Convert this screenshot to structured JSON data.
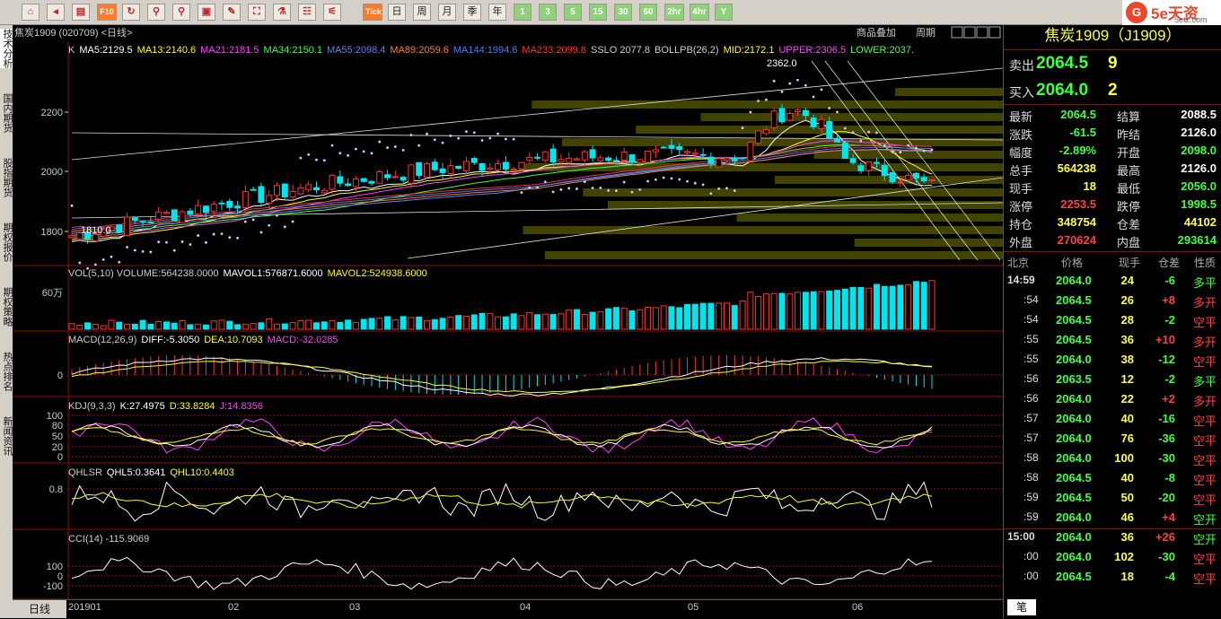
{
  "toolbar": {
    "buttons": [
      "⌂",
      "◂",
      "▤",
      "F10",
      "↻",
      "⚲",
      "⚲",
      "▣",
      "✎",
      "⛶",
      "⚗",
      "☷",
      "⚟",
      "Tick",
      "日",
      "周",
      "月",
      "季",
      "年",
      "1",
      "3",
      "5",
      "15",
      "30",
      "60",
      "2hr",
      "4hr",
      "Y"
    ],
    "logo": {
      "mark": "G",
      "brand": "5e天资",
      "domain": "5etz.com"
    }
  },
  "sidebar": [
    "技术分析",
    "国内期货",
    "股指期货",
    "期权报价",
    "期权策略",
    "热点排名",
    "新闻资讯"
  ],
  "chart": {
    "header": "焦炭1909 (020709) <日线>",
    "ma_legend": [
      {
        "text": "K",
        "color": "#cccccc"
      },
      {
        "text": "MA5:2129.5",
        "color": "#ffffff"
      },
      {
        "text": "MA13:2140.6",
        "color": "#ffff00"
      },
      {
        "text": "MA21:2181.5",
        "color": "#ff40ff"
      },
      {
        "text": "MA34:2150.1",
        "color": "#40ff40"
      },
      {
        "text": "MA55:2098.4",
        "color": "#6080ff"
      },
      {
        "text": "MA89:2059.6",
        "color": "#ff8020"
      },
      {
        "text": "MA144:1994.6",
        "color": "#4080ff"
      },
      {
        "text": "MA233:2099.8",
        "color": "#ff3030"
      },
      {
        "text": "SSLO 2077.8",
        "color": "#cccccc"
      },
      {
        "text": "BOLLPB(26,2)",
        "color": "#cccccc"
      },
      {
        "text": "MID:2172.1",
        "color": "#ffff00"
      },
      {
        "text": "UPPER:2306.5",
        "color": "#ff40ff"
      },
      {
        "text": "LOWER:2037.",
        "color": "#40ff40"
      }
    ],
    "price_axis": [
      "2200",
      "2000",
      "1800"
    ],
    "high_label": "2362.0",
    "low_label": "1810.0",
    "links": [
      "商品叠加",
      "周期"
    ],
    "vol": {
      "legend": [
        {
          "text": "VOL(5,10) VOLUME:564238.0000",
          "color": "#cccccc"
        },
        {
          "text": "MAVOL1:576871.6000",
          "color": "#ffffff"
        },
        {
          "text": "MAVOL2:524938.6000",
          "color": "#ffff00"
        }
      ],
      "axis": "60万"
    },
    "macd": {
      "legend": [
        {
          "text": "MACD(12,26,9)",
          "color": "#cccccc"
        },
        {
          "text": "DIFF:-5.3050",
          "color": "#ffffff"
        },
        {
          "text": "DEA:10.7093",
          "color": "#ffff00"
        },
        {
          "text": "MACD:-32.0285",
          "color": "#ff40ff"
        }
      ],
      "axis": "0"
    },
    "kdj": {
      "legend": [
        {
          "text": "KDJ(9,3,3)",
          "color": "#cccccc"
        },
        {
          "text": "K:27.4975",
          "color": "#ffffff"
        },
        {
          "text": "D:33.8284",
          "color": "#ffff00"
        },
        {
          "text": "J:14.8356",
          "color": "#ff40ff"
        }
      ],
      "axis": [
        "100",
        "80",
        "50",
        "20",
        "0"
      ]
    },
    "qhlsr": {
      "legend": [
        {
          "text": "QHLSR",
          "color": "#cccccc"
        },
        {
          "text": "QHL5:0.3641",
          "color": "#ffffff"
        },
        {
          "text": "QHL10:0.4403",
          "color": "#ffff00"
        }
      ],
      "axis": "0.8"
    },
    "cci": {
      "legend": [
        {
          "text": "CCI(14) -115.9069",
          "color": "#cccccc"
        }
      ],
      "axis": [
        "100",
        "0",
        "-100"
      ]
    }
  },
  "bottom": {
    "period": "日线",
    "dates": [
      "201901",
      "02",
      "03",
      "04",
      "05",
      "06"
    ]
  },
  "quote": {
    "title": "焦炭1909（J1909）",
    "ask": {
      "label": "卖出",
      "price": "2064.5",
      "vol": "9"
    },
    "bid": {
      "label": "买入",
      "price": "2064.0",
      "vol": "2"
    },
    "rows": [
      {
        "l1": "最新",
        "v1": "2064.5",
        "c1": "#40ff40",
        "l2": "结算",
        "v2": "2088.5",
        "c2": "#ffffff"
      },
      {
        "l1": "涨跌",
        "v1": "-61.5",
        "c1": "#40ff40",
        "l2": "昨结",
        "v2": "2126.0",
        "c2": "#ffffff"
      },
      {
        "l1": "幅度",
        "v1": "-2.89%",
        "c1": "#40ff40",
        "l2": "开盘",
        "v2": "2098.0",
        "c2": "#40ff40"
      },
      {
        "l1": "总手",
        "v1": "564238",
        "c1": "#ffff40",
        "l2": "最高",
        "v2": "2126.0",
        "c2": "#ffffff"
      },
      {
        "l1": "现手",
        "v1": "18",
        "c1": "#ffff40",
        "l2": "最低",
        "v2": "2056.0",
        "c2": "#40ff40"
      },
      {
        "l1": "涨停",
        "v1": "2253.5",
        "c1": "#ff4040",
        "l2": "跌停",
        "v2": "1998.5",
        "c2": "#40ff40"
      },
      {
        "l1": "持仓",
        "v1": "348754",
        "c1": "#ffff40",
        "l2": "仓差",
        "v2": "44102",
        "c2": "#ffff40"
      },
      {
        "l1": "外盘",
        "v1": "270624",
        "c1": "#ff4040",
        "l2": "内盘",
        "v2": "293614",
        "c2": "#40ff40"
      }
    ],
    "ticks_header": [
      "北京",
      "价格",
      "现手",
      "仓差",
      "性质"
    ],
    "ticks": [
      {
        "t": "14:59",
        "p": "2064.0",
        "pc": "#40ff40",
        "v": "24",
        "d": "-6",
        "dc": "#40ff40",
        "n": "多平",
        "nc": "#40ff40"
      },
      {
        "t": ":54",
        "p": "2064.5",
        "pc": "#40ff40",
        "v": "26",
        "d": "+8",
        "dc": "#ff4040",
        "n": "多开",
        "nc": "#ff4040"
      },
      {
        "t": ":54",
        "p": "2064.5",
        "pc": "#40ff40",
        "v": "28",
        "d": "-2",
        "dc": "#40ff40",
        "n": "空平",
        "nc": "#ff4040"
      },
      {
        "t": ":55",
        "p": "2064.5",
        "pc": "#40ff40",
        "v": "36",
        "d": "+10",
        "dc": "#ff4040",
        "n": "多开",
        "nc": "#ff4040"
      },
      {
        "t": ":55",
        "p": "2064.0",
        "pc": "#40ff40",
        "v": "38",
        "d": "-12",
        "dc": "#40ff40",
        "n": "空平",
        "nc": "#ff4040"
      },
      {
        "t": ":56",
        "p": "2063.5",
        "pc": "#40ff40",
        "v": "12",
        "d": "-2",
        "dc": "#40ff40",
        "n": "多平",
        "nc": "#40ff40"
      },
      {
        "t": ":56",
        "p": "2064.0",
        "pc": "#40ff40",
        "v": "22",
        "d": "+2",
        "dc": "#ff4040",
        "n": "多开",
        "nc": "#ff4040"
      },
      {
        "t": ":57",
        "p": "2064.0",
        "pc": "#40ff40",
        "v": "40",
        "d": "-16",
        "dc": "#40ff40",
        "n": "空平",
        "nc": "#ff4040"
      },
      {
        "t": ":57",
        "p": "2064.0",
        "pc": "#40ff40",
        "v": "76",
        "d": "-36",
        "dc": "#40ff40",
        "n": "空平",
        "nc": "#ff4040"
      },
      {
        "t": ":58",
        "p": "2064.0",
        "pc": "#40ff40",
        "v": "100",
        "d": "-30",
        "dc": "#40ff40",
        "n": "空平",
        "nc": "#ff4040"
      },
      {
        "t": ":58",
        "p": "2064.5",
        "pc": "#40ff40",
        "v": "40",
        "d": "-8",
        "dc": "#40ff40",
        "n": "空平",
        "nc": "#ff4040"
      },
      {
        "t": ":59",
        "p": "2064.5",
        "pc": "#40ff40",
        "v": "50",
        "d": "-20",
        "dc": "#40ff40",
        "n": "空平",
        "nc": "#ff4040"
      },
      {
        "t": ":59",
        "p": "2064.0",
        "pc": "#40ff40",
        "v": "46",
        "d": "+4",
        "dc": "#ff4040",
        "n": "空开",
        "nc": "#40ff40"
      },
      {
        "t": "15:00",
        "p": "2064.0",
        "pc": "#40ff40",
        "v": "36",
        "d": "+26",
        "dc": "#ff4040",
        "n": "空开",
        "nc": "#40ff40"
      },
      {
        "t": ":00",
        "p": "2064.0",
        "pc": "#40ff40",
        "v": "102",
        "d": "-30",
        "dc": "#40ff40",
        "n": "空平",
        "nc": "#ff4040"
      },
      {
        "t": ":00",
        "p": "2064.5",
        "pc": "#40ff40",
        "v": "18",
        "d": "-4",
        "dc": "#40ff40",
        "n": "空平",
        "nc": "#ff4040"
      }
    ],
    "footer_tab": "笔"
  },
  "colors": {
    "up": "#ff3030",
    "down": "#00e5ee",
    "grid": "#8c1010"
  }
}
